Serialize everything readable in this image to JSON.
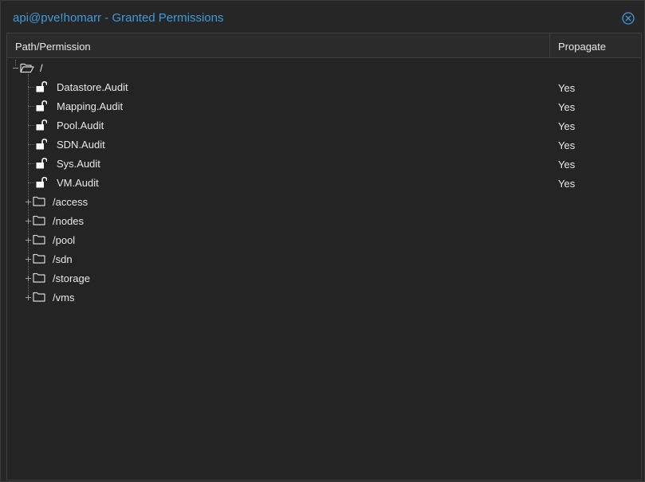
{
  "window": {
    "title": "api@pve!homarr - Granted Permissions",
    "accent_color": "#3f9ad9",
    "close_icon": "close-circle-icon"
  },
  "grid": {
    "columns": {
      "path": "Path/Permission",
      "propagate": "Propagate"
    }
  },
  "tree": {
    "root": {
      "label": "/",
      "icon": "folder-open-icon",
      "expanded": true
    },
    "permissions": [
      {
        "label": "Datastore.Audit",
        "propagate": "Yes",
        "icon": "unlock-icon"
      },
      {
        "label": "Mapping.Audit",
        "propagate": "Yes",
        "icon": "unlock-icon"
      },
      {
        "label": "Pool.Audit",
        "propagate": "Yes",
        "icon": "unlock-icon"
      },
      {
        "label": "SDN.Audit",
        "propagate": "Yes",
        "icon": "unlock-icon"
      },
      {
        "label": "Sys.Audit",
        "propagate": "Yes",
        "icon": "unlock-icon"
      },
      {
        "label": "VM.Audit",
        "propagate": "Yes",
        "icon": "unlock-icon"
      }
    ],
    "folders": [
      {
        "label": "/access",
        "icon": "folder-icon",
        "expanded": false
      },
      {
        "label": "/nodes",
        "icon": "folder-icon",
        "expanded": false
      },
      {
        "label": "/pool",
        "icon": "folder-icon",
        "expanded": false
      },
      {
        "label": "/sdn",
        "icon": "folder-icon",
        "expanded": false
      },
      {
        "label": "/storage",
        "icon": "folder-icon",
        "expanded": false
      },
      {
        "label": "/vms",
        "icon": "folder-icon",
        "expanded": false
      }
    ]
  }
}
